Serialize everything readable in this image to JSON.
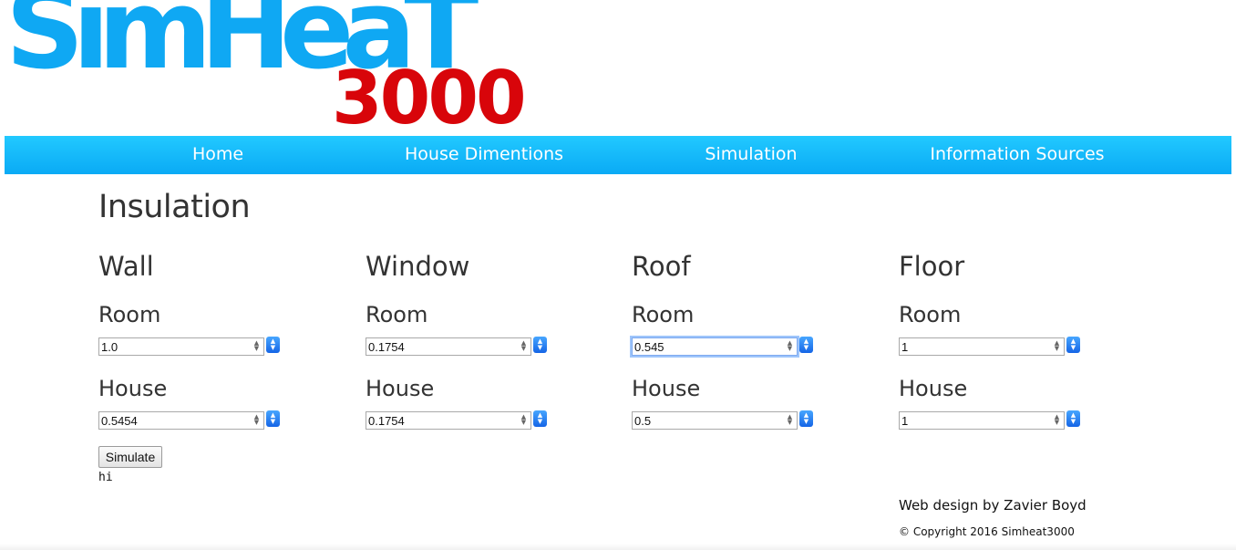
{
  "logo": {
    "main_text": "SimHeaT",
    "number_text": "3000"
  },
  "nav": {
    "items": [
      {
        "label": "Home"
      },
      {
        "label": "House Dimentions"
      },
      {
        "label": "Simulation"
      },
      {
        "label": "Information Sources"
      }
    ]
  },
  "page": {
    "title": "Insulation"
  },
  "columns": [
    {
      "heading": "Wall",
      "room_label": "Room",
      "room_value": "1.0",
      "house_label": "House",
      "house_value": "0.5454"
    },
    {
      "heading": "Window",
      "room_label": "Room",
      "room_value": "0.1754",
      "house_label": "House",
      "house_value": "0.1754"
    },
    {
      "heading": "Roof",
      "room_label": "Room",
      "room_value": "0.545",
      "house_label": "House",
      "house_value": "0.5"
    },
    {
      "heading": "Floor",
      "room_label": "Room",
      "room_value": "1",
      "house_label": "House",
      "house_value": "1"
    }
  ],
  "simulate_button": {
    "label": "Simulate"
  },
  "result_text": "hi",
  "footer": {
    "credit": "Web design by Zavier Boyd",
    "copyright": "© Copyright 2016 Simheat3000"
  },
  "colors": {
    "nav_blue": "#0aaaf5",
    "logo_blue": "#0fa8f3",
    "logo_red": "#d8050a"
  },
  "icons": {
    "spinner": "spin-arrows-icon",
    "select": "select-chevron-icon"
  }
}
